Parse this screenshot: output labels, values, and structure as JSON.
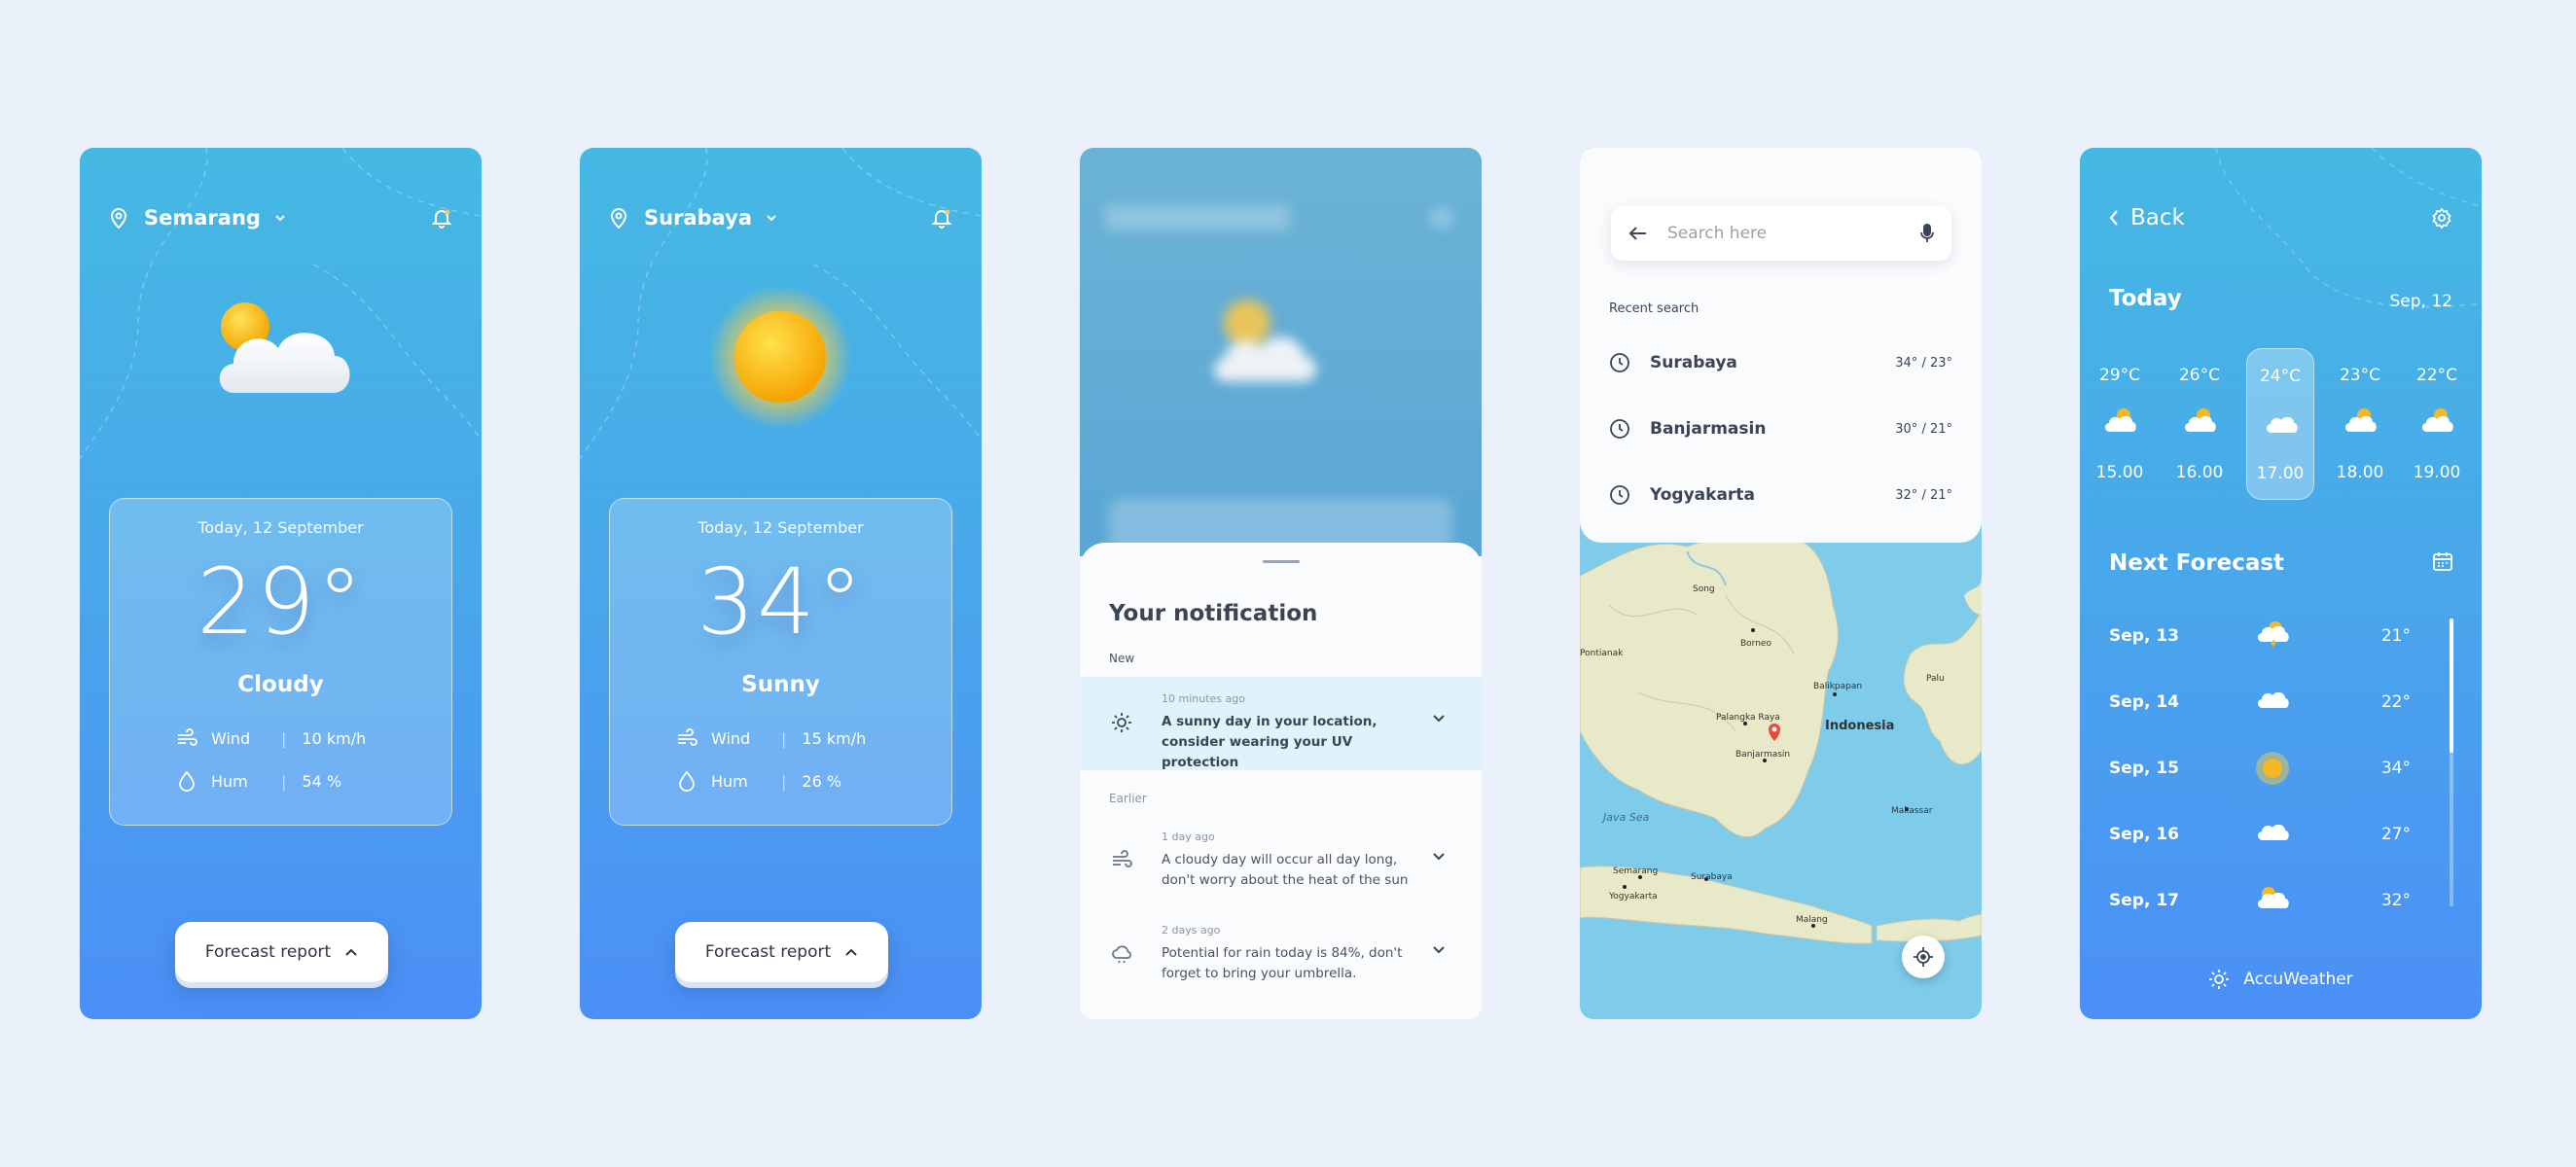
{
  "screen1": {
    "city": "Semarang",
    "date": "Today, 12 September",
    "temp": "29°",
    "condition": "Cloudy",
    "wind_label": "Wind",
    "wind_value": "10 km/h",
    "hum_label": "Hum",
    "hum_value": "54 %",
    "forecast_button": "Forecast report",
    "weather_icon": "cloud-sun-icon"
  },
  "screen2": {
    "city": "Surabaya",
    "date": "Today, 12 September",
    "temp": "34°",
    "condition": "Sunny",
    "wind_label": "Wind",
    "wind_value": "15 km/h",
    "hum_label": "Hum",
    "hum_value": "26 %",
    "forecast_button": "Forecast report",
    "weather_icon": "sun-icon"
  },
  "notifications": {
    "title": "Your notification",
    "new_label": "New",
    "earlier_label": "Earlier",
    "items": [
      {
        "time": "10 minutes ago",
        "text": "A sunny day in your location, consider wearing your UV protection",
        "icon": "sun-icon",
        "highlight": true
      },
      {
        "time": "1 day ago",
        "text": "A cloudy day will occur all day long, don't worry about the heat of the sun",
        "icon": "wind-icon",
        "highlight": false
      },
      {
        "time": "2 days ago",
        "text": "Potential for rain today is 84%, don't forget to bring your umbrella.",
        "icon": "cloud-rain-icon",
        "highlight": false
      }
    ]
  },
  "search": {
    "placeholder": "Search here",
    "recent_label": "Recent search",
    "recent": [
      {
        "city": "Surabaya",
        "temps": "34° / 23°"
      },
      {
        "city": "Banjarmasin",
        "temps": "30° / 21°"
      },
      {
        "city": "Yogyakarta",
        "temps": "32° / 21°"
      }
    ],
    "map_labels": {
      "indonesia": "Indonesia",
      "java_sea": "Java Sea",
      "song": "Song",
      "pontianak": "Pontianak",
      "borneo": "Borneo",
      "balikpapan": "Balikpapan",
      "palu": "Palu",
      "palangka": "Palangka Raya",
      "banjarmasin": "Banjarmasin",
      "makassar": "Makassar",
      "semarang": "Semarang",
      "surabaya": "Surabaya",
      "yogyakarta": "Yogyakarta",
      "malang": "Malang"
    }
  },
  "forecast": {
    "back_label": "Back",
    "today_label": "Today",
    "today_date": "Sep, 12",
    "hourly": [
      {
        "temp": "29°C",
        "time": "15.00",
        "icon": "cloud-sun-icon",
        "selected": false
      },
      {
        "temp": "26°C",
        "time": "16.00",
        "icon": "cloud-sun-icon",
        "selected": false
      },
      {
        "temp": "24°C",
        "time": "17.00",
        "icon": "cloud-icon",
        "selected": true
      },
      {
        "temp": "23°C",
        "time": "18.00",
        "icon": "cloud-sun-icon",
        "selected": false
      },
      {
        "temp": "22°C",
        "time": "19.00",
        "icon": "cloud-sun-icon",
        "selected": false
      }
    ],
    "next_label": "Next Forecast",
    "days": [
      {
        "date": "Sep, 13",
        "temp": "21°",
        "icon": "storm-icon"
      },
      {
        "date": "Sep, 14",
        "temp": "22°",
        "icon": "cloud-icon"
      },
      {
        "date": "Sep, 15",
        "temp": "34°",
        "icon": "sun-icon"
      },
      {
        "date": "Sep, 16",
        "temp": "27°",
        "icon": "cloud-icon"
      },
      {
        "date": "Sep, 17",
        "temp": "32°",
        "icon": "cloud-sun-icon"
      }
    ],
    "provider": "AccuWeather"
  },
  "colors": {
    "sky_top": "#45b8e3",
    "sky_bottom": "#4b8ff6",
    "notification_highlight": "#dff4fa",
    "text_dark": "#3b4457"
  }
}
